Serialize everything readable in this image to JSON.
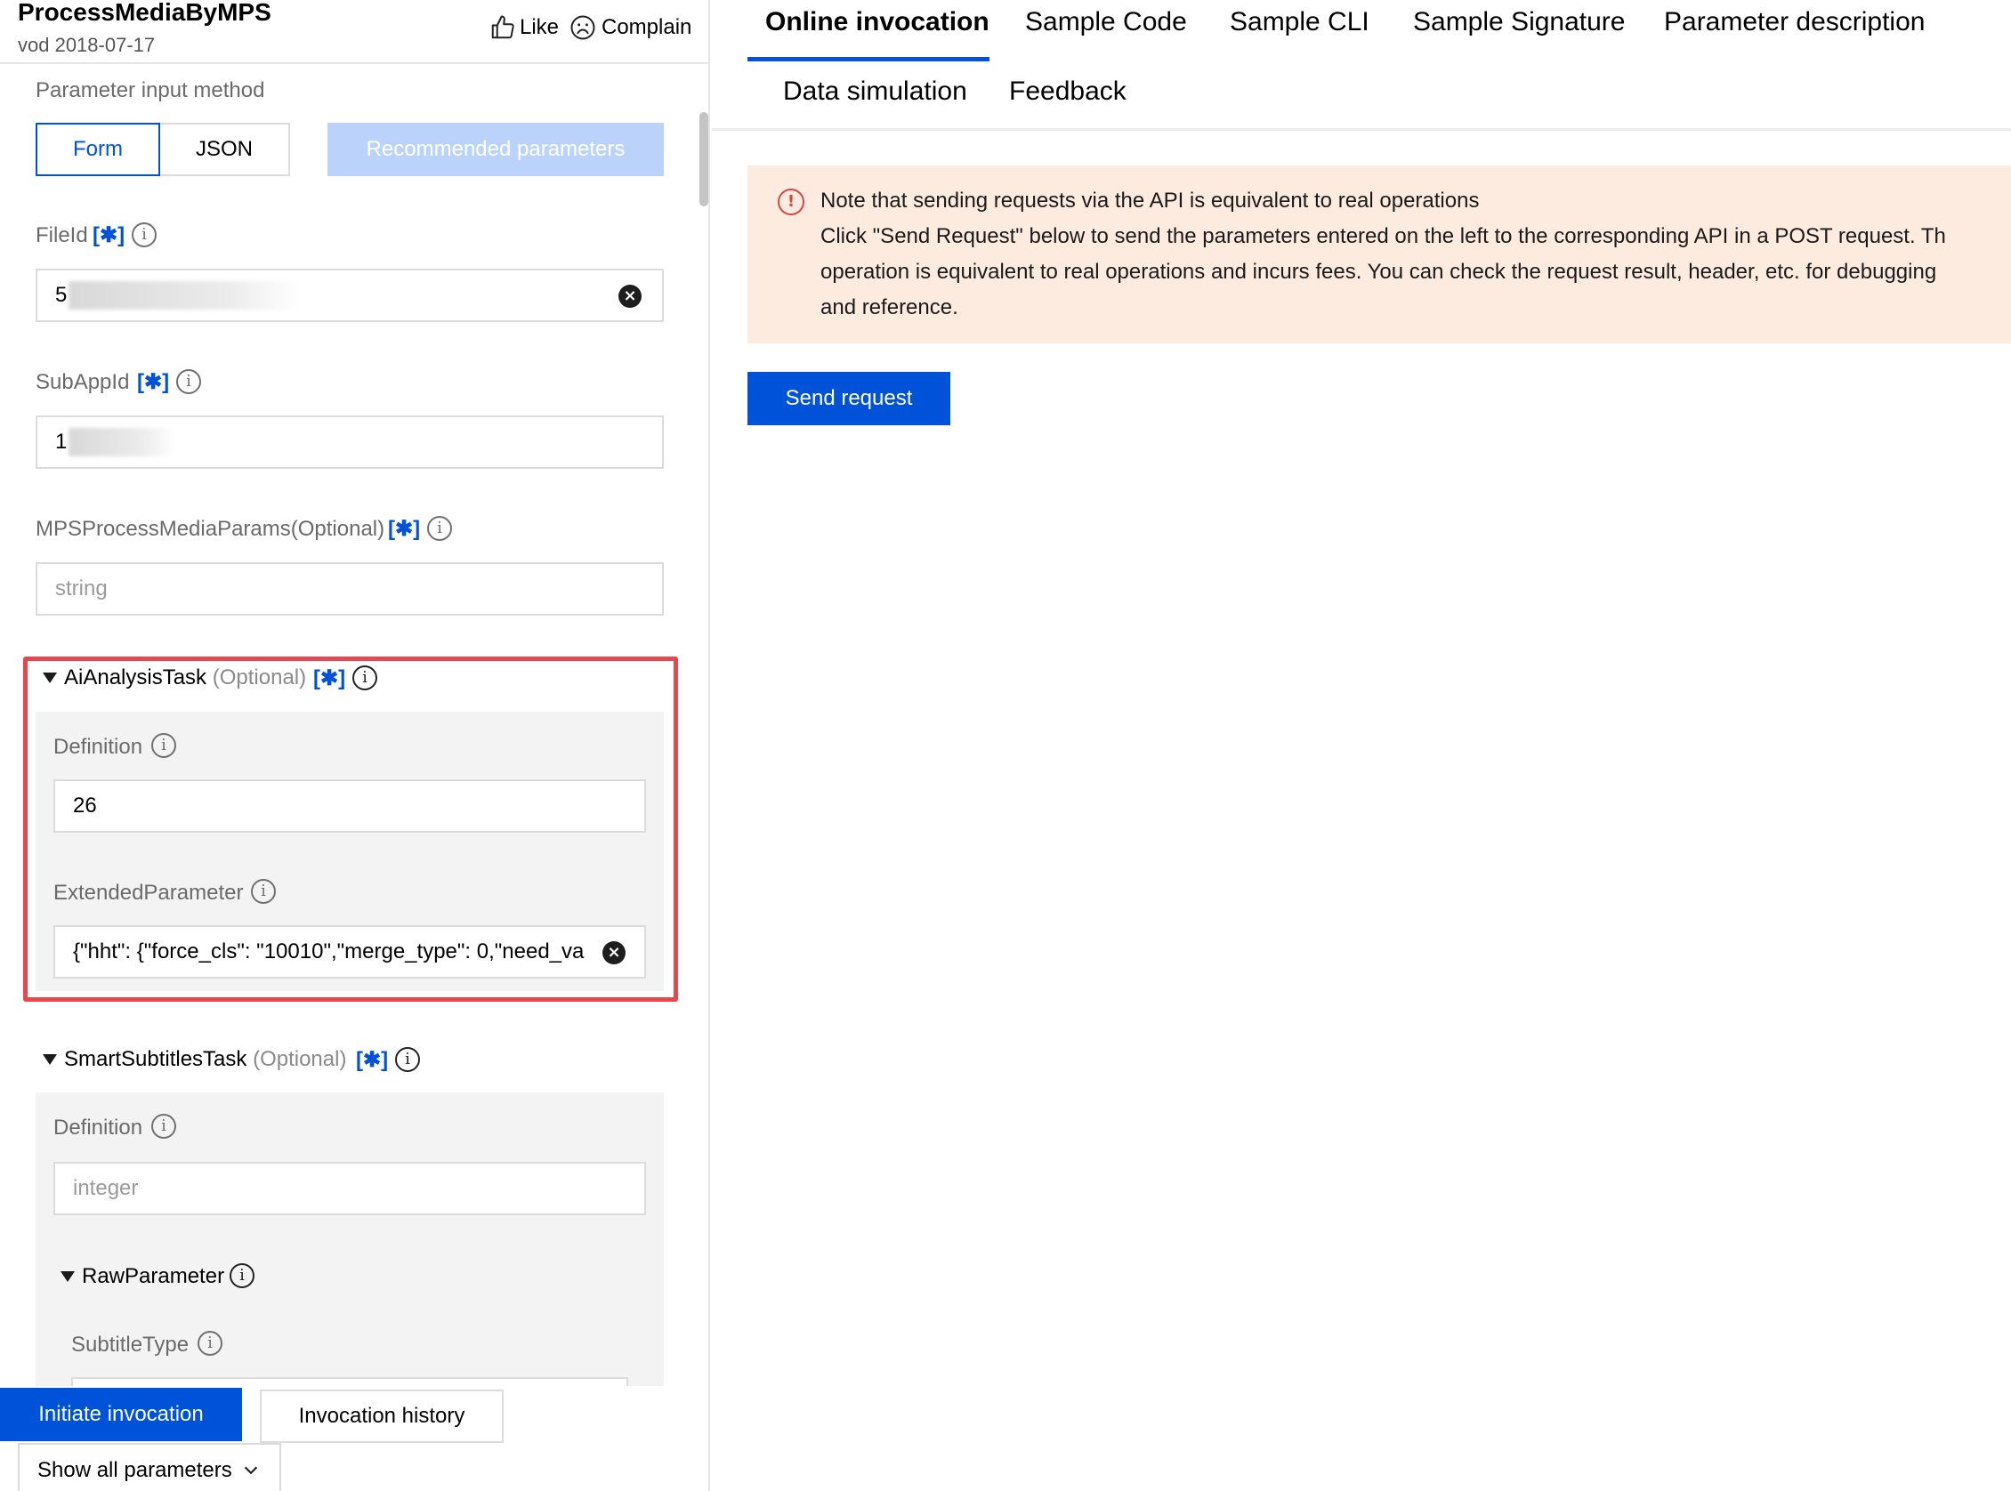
{
  "left": {
    "title": "ProcessMediaByMPS",
    "subtitle": "vod 2018-07-17",
    "like_label": "Like",
    "complain_label": "Complain",
    "input_method_label": "Parameter input method",
    "input_methods": [
      "Form",
      "JSON"
    ],
    "recommended_label": "Recommended parameters",
    "fields": {
      "fileid": {
        "label": "FileId",
        "value": "5"
      },
      "subappid": {
        "label": "SubAppId",
        "value": "1"
      },
      "mps_params": {
        "label": "MPSProcessMediaParams(Optional)",
        "placeholder": "string"
      }
    },
    "ai_task": {
      "name": "AiAnalysisTask",
      "optional": "(Optional)",
      "definition_label": "Definition",
      "definition_value": "26",
      "ext_label": "ExtendedParameter",
      "ext_value": "{\"hht\": {\"force_cls\": \"10010\",\"merge_type\": 0,\"need_va"
    },
    "subtitles_task": {
      "name": "SmartSubtitlesTask",
      "optional": "(Optional)",
      "definition_label": "Definition",
      "definition_placeholder": "integer",
      "raw_label": "RawParameter",
      "subtitle_type_label": "SubtitleType"
    },
    "star_symbol": "[✱]",
    "initiate_label": "Initiate invocation",
    "history_label": "Invocation history",
    "show_all_label": "Show all parameters"
  },
  "right": {
    "tabs": [
      "Online invocation",
      "Sample Code",
      "Sample CLI",
      "Sample Signature",
      "Parameter description",
      "Data simulation",
      "Feedback"
    ],
    "notice_title": "Note that sending requests via the API is equivalent to real operations",
    "notice_lines": [
      "Click \"Send Request\" below to send the parameters entered on the left to the corresponding API in a POST request. Th",
      "operation is equivalent to real operations and incurs fees. You can check the request result, header, etc. for debugging",
      "and reference."
    ],
    "send_label": "Send request"
  },
  "colors": {
    "accent": "#0052d9",
    "highlight_border": "#e5484d",
    "notice_bg": "#fdebe0",
    "notice_icon": "#d54941"
  }
}
